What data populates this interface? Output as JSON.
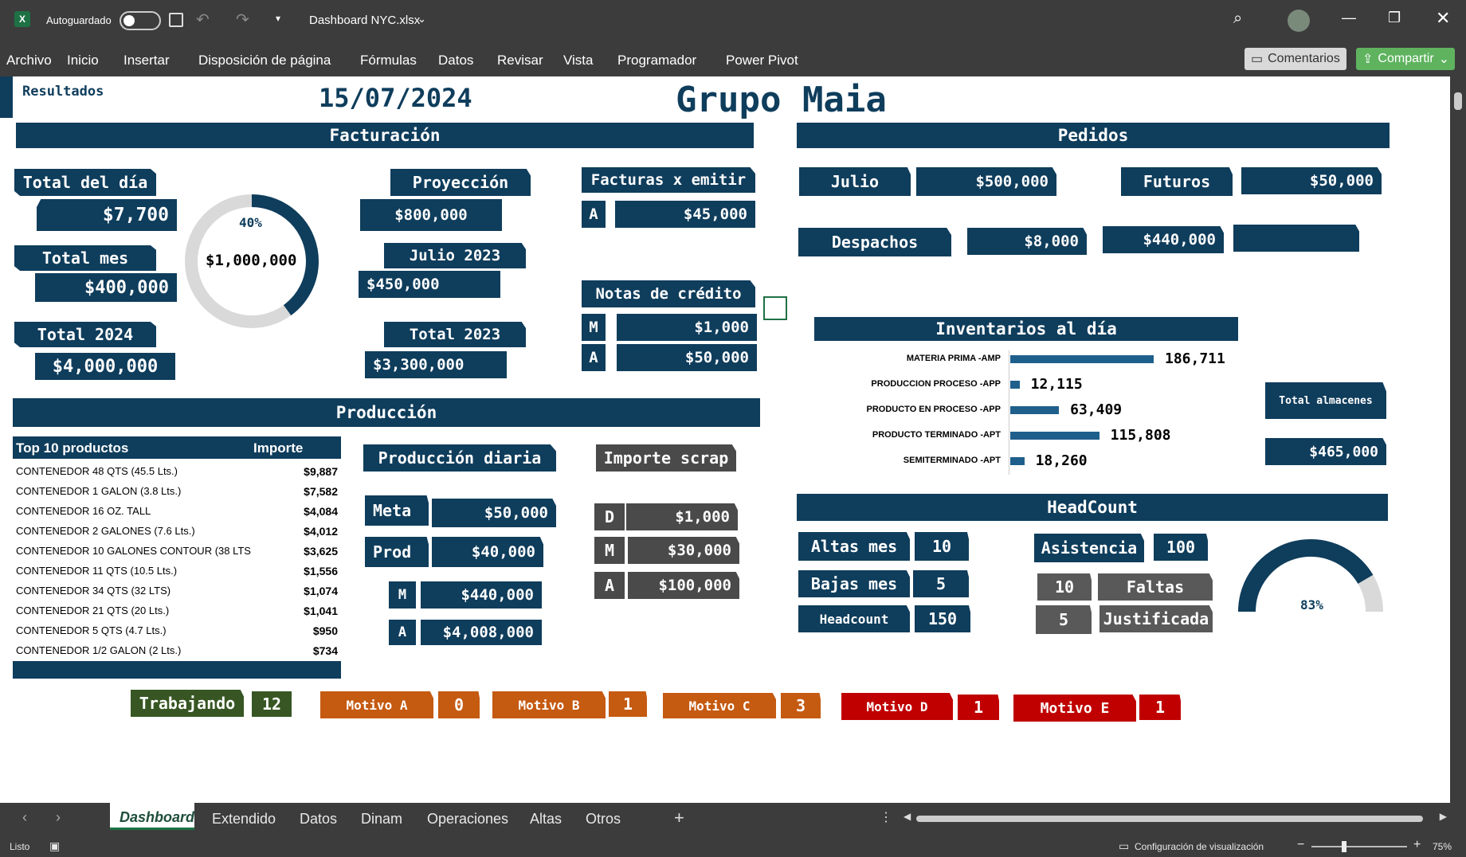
{
  "window": {
    "autosave_label": "Autoguardado",
    "filename": "Dashboard NYC.xlsx"
  },
  "menu": [
    "Archivo",
    "Inicio",
    "Insertar",
    "Disposición de página",
    "Fórmulas",
    "Datos",
    "Revisar",
    "Vista",
    "Programador",
    "Power Pivot"
  ],
  "ribbon": {
    "comments": "Comentarios",
    "share": "Compartir"
  },
  "dashboard": {
    "results_label": "Resultados",
    "date": "15/07/2024",
    "company": "Grupo Maia",
    "facturacion": {
      "title": "Facturación",
      "total_dia_label": "Total del día",
      "total_dia": "$7,700",
      "total_mes_label": "Total mes",
      "total_mes": "$400,000",
      "total_2024_label": "Total 2024",
      "total_2024": "$4,000,000",
      "donut_pct": "40%",
      "donut_pct_value": 0.4,
      "donut_value": "$1,000,000",
      "proyeccion_label": "Proyección",
      "proyeccion": "$800,000",
      "julio2023_label": "Julio 2023",
      "julio2023": "$450,000",
      "total2023_label": "Total 2023",
      "total2023": "$3,300,000",
      "facturas_label": "Facturas x emitir",
      "facturas_a_letter": "A",
      "facturas_a": "$45,000",
      "notas_label": "Notas de crédito",
      "notas_m_letter": "M",
      "notas_m": "$1,000",
      "notas_a_letter": "A",
      "notas_a": "$50,000"
    },
    "pedidos": {
      "title": "Pedidos",
      "julio_label": "Julio",
      "julio": "$500,000",
      "futuros_label": "Futuros",
      "futuros": "$50,000",
      "despachos_label": "Despachos",
      "despachos": "$8,000",
      "despachos2": "$440,000"
    },
    "inventarios": {
      "title": "Inventarios al día",
      "items": [
        {
          "label": "MATERIA PRIMA -AMP",
          "value": "186,711",
          "num": 186711
        },
        {
          "label": "PRODUCCION PROCESO -APP",
          "value": "12,115",
          "num": 12115
        },
        {
          "label": "PRODUCTO EN PROCESO -APP",
          "value": "63,409",
          "num": 63409
        },
        {
          "label": "PRODUCTO TERMINADO -APT",
          "value": "115,808",
          "num": 115808
        },
        {
          "label": "SEMITERMINADO -APT",
          "value": "18,260",
          "num": 18260
        }
      ],
      "total_label": "Total almacenes",
      "total": "$465,000"
    },
    "produccion": {
      "title": "Producción",
      "top10_header": "Top 10 productos",
      "importe_header": "Importe",
      "top10": [
        {
          "name": "CONTENEDOR 48 QTS (45.5 Lts.)",
          "amount": "$9,887"
        },
        {
          "name": "CONTENEDOR 1 GALON (3.8 Lts.)",
          "amount": "$7,582"
        },
        {
          "name": "CONTENEDOR 16 OZ. TALL",
          "amount": "$4,084"
        },
        {
          "name": "CONTENEDOR 2 GALONES (7.6 Lts.)",
          "amount": "$4,012"
        },
        {
          "name": "CONTENEDOR 10 GALONES CONTOUR (38 LTS",
          "amount": "$3,625"
        },
        {
          "name": "CONTENEDOR 11 QTS (10.5 Lts.)",
          "amount": "$1,556"
        },
        {
          "name": "CONTENEDOR 34 QTS (32 LTS)",
          "amount": "$1,074"
        },
        {
          "name": "CONTENEDOR 21 QTS (20 Lts.)",
          "amount": "$1,041"
        },
        {
          "name": "CONTENEDOR  5 QTS (4.7 Lts.)",
          "amount": "$950"
        },
        {
          "name": "CONTENEDOR 1/2 GALON (2 Lts.)",
          "amount": "$734"
        }
      ],
      "diaria_label": "Producción diaria",
      "meta_label": "Meta",
      "meta": "$50,000",
      "prod_label": "Prod",
      "prod": "$40,000",
      "m_letter": "M",
      "m_value": "$440,000",
      "a_letter": "A",
      "a_value": "$4,008,000",
      "scrap_label": "Importe scrap",
      "scrap_d_letter": "D",
      "scrap_d": "$1,000",
      "scrap_m_letter": "M",
      "scrap_m": "$30,000",
      "scrap_a_letter": "A",
      "scrap_a": "$100,000"
    },
    "headcount": {
      "title": "HeadCount",
      "altas_label": "Altas mes",
      "altas": "10",
      "bajas_label": "Bajas mes",
      "bajas": "5",
      "headcount_label": "Headcount",
      "headcount": "150",
      "asistencia_label": "Asistencia",
      "asistencia": "100",
      "faltas_num": "10",
      "faltas_label": "Faltas",
      "just_num": "5",
      "just_label": "Justificada",
      "gauge_pct": "83%",
      "gauge_value": 0.83
    },
    "status_row": [
      {
        "label": "Trabajando",
        "value": "12",
        "color": "#375623"
      },
      {
        "label": "Motivo A",
        "value": "0",
        "color": "#c55a11"
      },
      {
        "label": "Motivo B",
        "value": "1",
        "color": "#c55a11"
      },
      {
        "label": "Motivo C",
        "value": "3",
        "color": "#c55a11"
      },
      {
        "label": "Motivo D",
        "value": "1",
        "color": "#c00000"
      },
      {
        "label": "Motivo E",
        "value": "1",
        "color": "#c00000"
      }
    ]
  },
  "sheet_tabs": [
    "Dashboard",
    "Extendido",
    "Datos",
    "Dinam",
    "Operaciones",
    "Altas",
    "Otros"
  ],
  "statusbar": {
    "ready": "Listo",
    "view_settings": "Configuración de visualización",
    "zoom": "75%"
  }
}
